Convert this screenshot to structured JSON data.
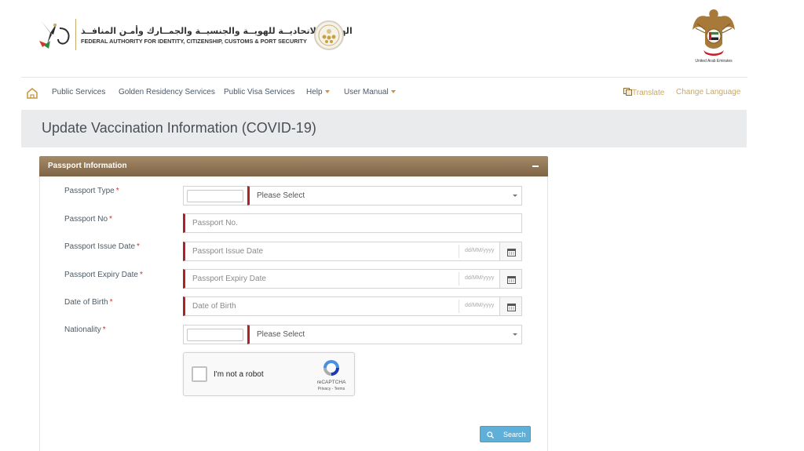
{
  "header": {
    "org_name_ar": "الهيئــة الاتحاديــة للهويــة والجنسيــة والجمــارك وأمـن المنافــذ",
    "org_name_en": "FEDERAL AUTHORITY FOR IDENTITY, CITIZENSHIP, CUSTOMS & PORT SECURITY",
    "emblem_caption": "United Arab Emirates",
    "brand_color": "#c8a864"
  },
  "nav": {
    "home_icon": "home-icon",
    "items": [
      {
        "label": "Public Services",
        "dropdown": false
      },
      {
        "label": "Golden Residency Services",
        "dropdown": false
      },
      {
        "label": "Public Visa Services",
        "dropdown": false
      },
      {
        "label": "Help",
        "dropdown": true
      },
      {
        "label": "User Manual",
        "dropdown": true
      }
    ],
    "translate_label": "Translate",
    "translate_icon": "translate-icon",
    "change_language_label": "Change Language"
  },
  "page": {
    "title": "Update Vaccination Information (COVID-19)"
  },
  "panel": {
    "title": "Passport Information",
    "header_color": "#8f7553",
    "fields": {
      "passport_type": {
        "label": "Passport Type",
        "required": "*",
        "select_value": "Please Select"
      },
      "passport_no": {
        "label": "Passport No",
        "required": "*",
        "placeholder": "Passport No."
      },
      "issue_date": {
        "label": "Passport Issue Date",
        "required": "*",
        "placeholder": "Passport Issue Date",
        "format_hint": "dd/MM/yyyy"
      },
      "expiry_date": {
        "label": "Passport Expiry Date",
        "required": "*",
        "placeholder": "Passport Expiry Date",
        "format_hint": "dd/MM/yyyy"
      },
      "dob": {
        "label": "Date of Birth",
        "required": "*",
        "placeholder": "Date of Birth",
        "format_hint": "dd/MM/yyyy"
      },
      "nationality": {
        "label": "Nationality",
        "required": "*",
        "select_value": "Please Select"
      }
    },
    "required_color": "#b22028"
  },
  "captcha": {
    "label": "I'm not a robot",
    "brand": "reCAPTCHA",
    "privacy": "Privacy",
    "separator": "-",
    "terms": "Terms"
  },
  "search_button": {
    "label": "Search",
    "icon": "search-icon",
    "color": "#5fb0d8"
  }
}
